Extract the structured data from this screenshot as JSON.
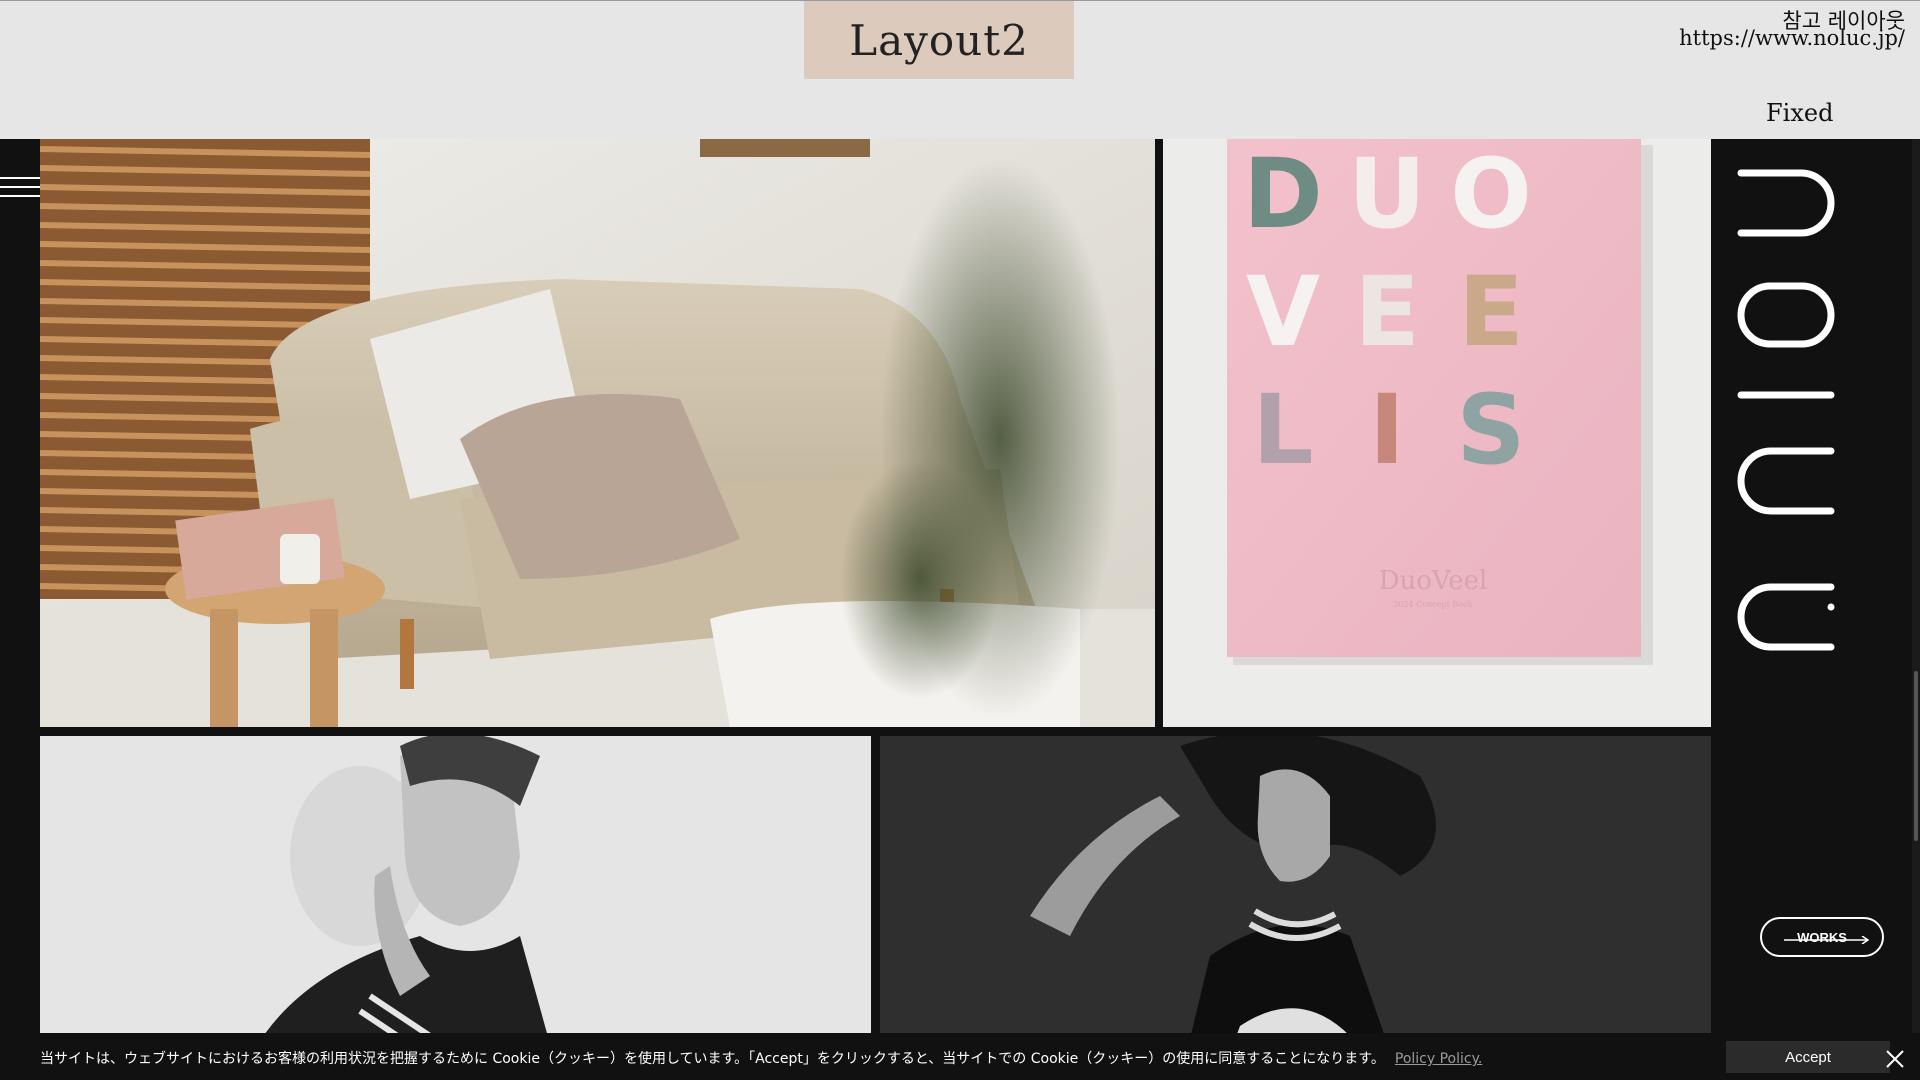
{
  "annotation": {
    "layout_tag": "Layout2",
    "reference_title": "참고 레이아웃",
    "reference_url": "https://www.noluc.jp/",
    "fixed_note": "Fixed"
  },
  "site": {
    "brand_logo": "noluc",
    "nav_icon": "hamburger-menu-icon",
    "works_button": "WORKS",
    "works_arrow_icon": "arrow-right-icon",
    "book_cover": {
      "letters": [
        "D",
        "U",
        "O",
        "V",
        "E",
        "E",
        "L",
        "I",
        "S"
      ],
      "brand": "DuoVeel",
      "subtitle": "2024 Concept Book"
    }
  },
  "cookie_banner": {
    "text": "当サイトは、ウェブサイトにおけるお客様の利用状況を把握するために Cookie（クッキー）を使用しています。「Accept」をクリックすると、当サイトでの Cookie（クッキー）の使用に同意することになります。",
    "policy_link": "Policy Policy.",
    "accept_label": "Accept",
    "close_icon": "close-icon"
  },
  "colors": {
    "page_bg": "#e6e6e6",
    "site_bg": "#111111",
    "layout_tag_bg": "#dccabc",
    "book_pink": "#f1bcc8"
  }
}
